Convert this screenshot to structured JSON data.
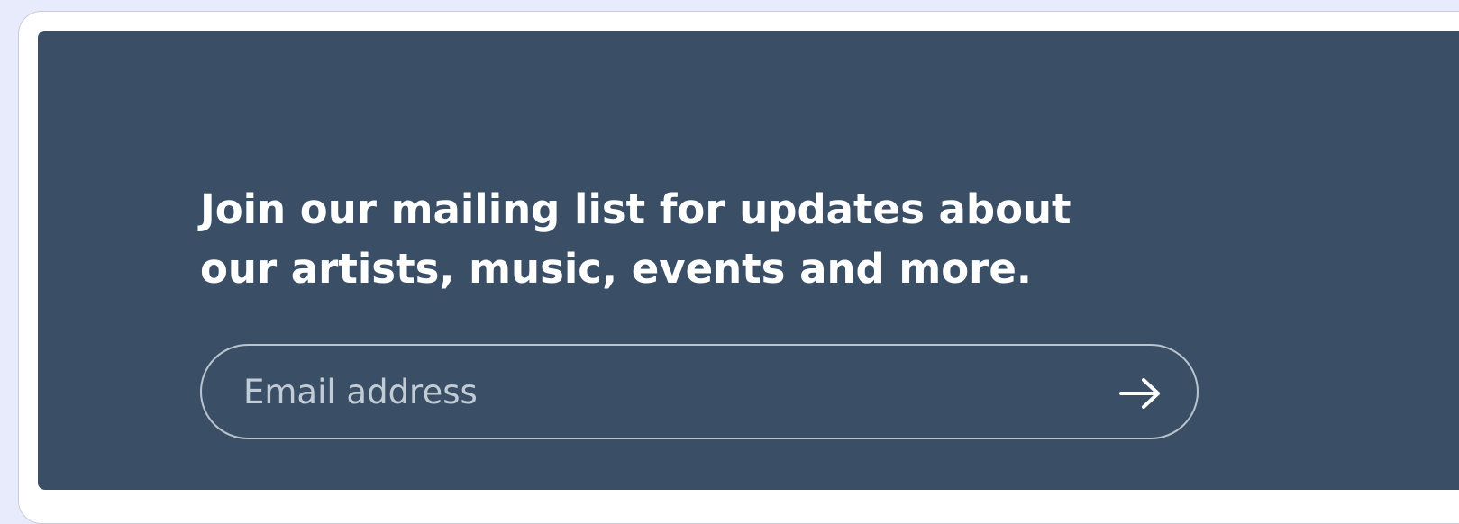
{
  "newsletter": {
    "headline": "Join our mailing list for updates about\nour artists, music, events and more.",
    "email_placeholder": "Email address",
    "email_value": "",
    "submit_icon": "arrow-right-icon"
  },
  "colors": {
    "page_background": "#e8ebfb",
    "card_background": "#ffffff",
    "panel_background": "#3a4f66",
    "text": "#ffffff",
    "placeholder": "#c2ccd7",
    "input_border": "#b9c4d0"
  }
}
